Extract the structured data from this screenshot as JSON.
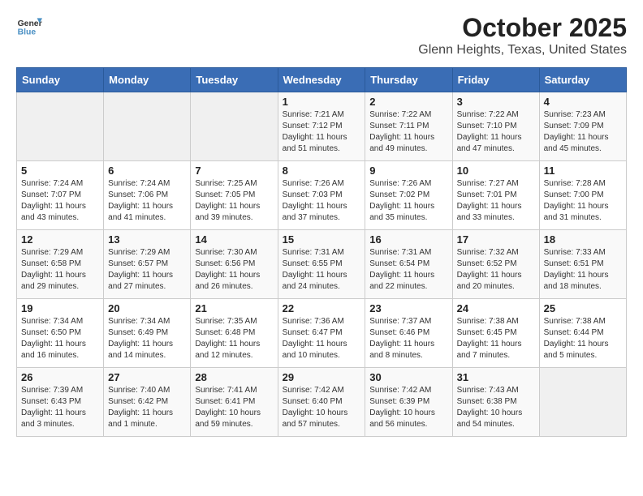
{
  "header": {
    "logo_line1": "General",
    "logo_line2": "Blue",
    "title": "October 2025",
    "subtitle": "Glenn Heights, Texas, United States"
  },
  "days_of_week": [
    "Sunday",
    "Monday",
    "Tuesday",
    "Wednesday",
    "Thursday",
    "Friday",
    "Saturday"
  ],
  "weeks": [
    [
      {
        "day": "",
        "info": ""
      },
      {
        "day": "",
        "info": ""
      },
      {
        "day": "",
        "info": ""
      },
      {
        "day": "1",
        "info": "Sunrise: 7:21 AM\nSunset: 7:12 PM\nDaylight: 11 hours\nand 51 minutes."
      },
      {
        "day": "2",
        "info": "Sunrise: 7:22 AM\nSunset: 7:11 PM\nDaylight: 11 hours\nand 49 minutes."
      },
      {
        "day": "3",
        "info": "Sunrise: 7:22 AM\nSunset: 7:10 PM\nDaylight: 11 hours\nand 47 minutes."
      },
      {
        "day": "4",
        "info": "Sunrise: 7:23 AM\nSunset: 7:09 PM\nDaylight: 11 hours\nand 45 minutes."
      }
    ],
    [
      {
        "day": "5",
        "info": "Sunrise: 7:24 AM\nSunset: 7:07 PM\nDaylight: 11 hours\nand 43 minutes."
      },
      {
        "day": "6",
        "info": "Sunrise: 7:24 AM\nSunset: 7:06 PM\nDaylight: 11 hours\nand 41 minutes."
      },
      {
        "day": "7",
        "info": "Sunrise: 7:25 AM\nSunset: 7:05 PM\nDaylight: 11 hours\nand 39 minutes."
      },
      {
        "day": "8",
        "info": "Sunrise: 7:26 AM\nSunset: 7:03 PM\nDaylight: 11 hours\nand 37 minutes."
      },
      {
        "day": "9",
        "info": "Sunrise: 7:26 AM\nSunset: 7:02 PM\nDaylight: 11 hours\nand 35 minutes."
      },
      {
        "day": "10",
        "info": "Sunrise: 7:27 AM\nSunset: 7:01 PM\nDaylight: 11 hours\nand 33 minutes."
      },
      {
        "day": "11",
        "info": "Sunrise: 7:28 AM\nSunset: 7:00 PM\nDaylight: 11 hours\nand 31 minutes."
      }
    ],
    [
      {
        "day": "12",
        "info": "Sunrise: 7:29 AM\nSunset: 6:58 PM\nDaylight: 11 hours\nand 29 minutes."
      },
      {
        "day": "13",
        "info": "Sunrise: 7:29 AM\nSunset: 6:57 PM\nDaylight: 11 hours\nand 27 minutes."
      },
      {
        "day": "14",
        "info": "Sunrise: 7:30 AM\nSunset: 6:56 PM\nDaylight: 11 hours\nand 26 minutes."
      },
      {
        "day": "15",
        "info": "Sunrise: 7:31 AM\nSunset: 6:55 PM\nDaylight: 11 hours\nand 24 minutes."
      },
      {
        "day": "16",
        "info": "Sunrise: 7:31 AM\nSunset: 6:54 PM\nDaylight: 11 hours\nand 22 minutes."
      },
      {
        "day": "17",
        "info": "Sunrise: 7:32 AM\nSunset: 6:52 PM\nDaylight: 11 hours\nand 20 minutes."
      },
      {
        "day": "18",
        "info": "Sunrise: 7:33 AM\nSunset: 6:51 PM\nDaylight: 11 hours\nand 18 minutes."
      }
    ],
    [
      {
        "day": "19",
        "info": "Sunrise: 7:34 AM\nSunset: 6:50 PM\nDaylight: 11 hours\nand 16 minutes."
      },
      {
        "day": "20",
        "info": "Sunrise: 7:34 AM\nSunset: 6:49 PM\nDaylight: 11 hours\nand 14 minutes."
      },
      {
        "day": "21",
        "info": "Sunrise: 7:35 AM\nSunset: 6:48 PM\nDaylight: 11 hours\nand 12 minutes."
      },
      {
        "day": "22",
        "info": "Sunrise: 7:36 AM\nSunset: 6:47 PM\nDaylight: 11 hours\nand 10 minutes."
      },
      {
        "day": "23",
        "info": "Sunrise: 7:37 AM\nSunset: 6:46 PM\nDaylight: 11 hours\nand 8 minutes."
      },
      {
        "day": "24",
        "info": "Sunrise: 7:38 AM\nSunset: 6:45 PM\nDaylight: 11 hours\nand 7 minutes."
      },
      {
        "day": "25",
        "info": "Sunrise: 7:38 AM\nSunset: 6:44 PM\nDaylight: 11 hours\nand 5 minutes."
      }
    ],
    [
      {
        "day": "26",
        "info": "Sunrise: 7:39 AM\nSunset: 6:43 PM\nDaylight: 11 hours\nand 3 minutes."
      },
      {
        "day": "27",
        "info": "Sunrise: 7:40 AM\nSunset: 6:42 PM\nDaylight: 11 hours\nand 1 minute."
      },
      {
        "day": "28",
        "info": "Sunrise: 7:41 AM\nSunset: 6:41 PM\nDaylight: 10 hours\nand 59 minutes."
      },
      {
        "day": "29",
        "info": "Sunrise: 7:42 AM\nSunset: 6:40 PM\nDaylight: 10 hours\nand 57 minutes."
      },
      {
        "day": "30",
        "info": "Sunrise: 7:42 AM\nSunset: 6:39 PM\nDaylight: 10 hours\nand 56 minutes."
      },
      {
        "day": "31",
        "info": "Sunrise: 7:43 AM\nSunset: 6:38 PM\nDaylight: 10 hours\nand 54 minutes."
      },
      {
        "day": "",
        "info": ""
      }
    ]
  ]
}
